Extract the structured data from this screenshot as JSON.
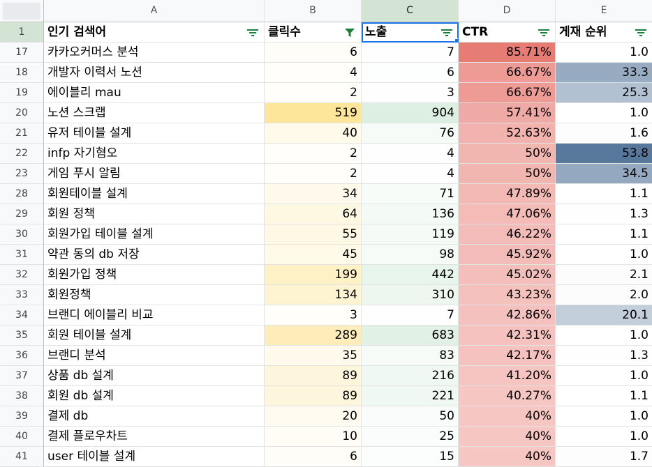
{
  "columns": [
    {
      "letter": "A"
    },
    {
      "letter": "B"
    },
    {
      "letter": "C"
    },
    {
      "letter": "D"
    },
    {
      "letter": "E"
    }
  ],
  "header_row": {
    "index": "1",
    "a": "인기 검색어",
    "b": "클릭수",
    "c": "노출",
    "d": "CTR",
    "e": "게재 순위"
  },
  "rows": [
    {
      "index": "17",
      "term": "카카오커머스 분석",
      "clicks": "6",
      "impressions": "7",
      "ctr": "85.71%",
      "position": "1.0"
    },
    {
      "index": "18",
      "term": "개발자 이력서 노션",
      "clicks": "4",
      "impressions": "6",
      "ctr": "66.67%",
      "position": "33.3"
    },
    {
      "index": "19",
      "term": "에이블리 mau",
      "clicks": "2",
      "impressions": "3",
      "ctr": "66.67%",
      "position": "25.3"
    },
    {
      "index": "20",
      "term": "노션 스크랩",
      "clicks": "519",
      "impressions": "904",
      "ctr": "57.41%",
      "position": "1.0"
    },
    {
      "index": "21",
      "term": "유저 테이블 설계",
      "clicks": "40",
      "impressions": "76",
      "ctr": "52.63%",
      "position": "1.6"
    },
    {
      "index": "22",
      "term": "infp 자기혐오",
      "clicks": "2",
      "impressions": "4",
      "ctr": "50%",
      "position": "53.8"
    },
    {
      "index": "23",
      "term": "게임 푸시 알림",
      "clicks": "2",
      "impressions": "4",
      "ctr": "50%",
      "position": "34.5"
    },
    {
      "index": "28",
      "term": "회원테이블 설계",
      "clicks": "34",
      "impressions": "71",
      "ctr": "47.89%",
      "position": "1.1"
    },
    {
      "index": "29",
      "term": "회원 정책",
      "clicks": "64",
      "impressions": "136",
      "ctr": "47.06%",
      "position": "1.3"
    },
    {
      "index": "30",
      "term": "회원가입 테이블 설계",
      "clicks": "55",
      "impressions": "119",
      "ctr": "46.22%",
      "position": "1.1"
    },
    {
      "index": "31",
      "term": "약관 동의 db 저장",
      "clicks": "45",
      "impressions": "98",
      "ctr": "45.92%",
      "position": "1.0"
    },
    {
      "index": "32",
      "term": "회원가입 정책",
      "clicks": "199",
      "impressions": "442",
      "ctr": "45.02%",
      "position": "2.1"
    },
    {
      "index": "33",
      "term": "회원정책",
      "clicks": "134",
      "impressions": "310",
      "ctr": "43.23%",
      "position": "2.0"
    },
    {
      "index": "34",
      "term": "브랜디 에이블리 비교",
      "clicks": "3",
      "impressions": "7",
      "ctr": "42.86%",
      "position": "20.1"
    },
    {
      "index": "35",
      "term": "회원 테이블 설계",
      "clicks": "289",
      "impressions": "683",
      "ctr": "42.31%",
      "position": "1.0"
    },
    {
      "index": "36",
      "term": "브랜디 분석",
      "clicks": "35",
      "impressions": "83",
      "ctr": "42.17%",
      "position": "1.3"
    },
    {
      "index": "37",
      "term": "상품 db 설계",
      "clicks": "89",
      "impressions": "216",
      "ctr": "41.20%",
      "position": "1.0"
    },
    {
      "index": "38",
      "term": "회원 db 설계",
      "clicks": "89",
      "impressions": "221",
      "ctr": "40.27%",
      "position": "1.1"
    },
    {
      "index": "39",
      "term": "결제 db",
      "clicks": "20",
      "impressions": "50",
      "ctr": "40%",
      "position": "1.0"
    },
    {
      "index": "40",
      "term": "결제 플로우차트",
      "clicks": "10",
      "impressions": "25",
      "ctr": "40%",
      "position": "1.0"
    },
    {
      "index": "41",
      "term": "user 테이블 설계",
      "clicks": "6",
      "impressions": "15",
      "ctr": "40%",
      "position": "1.7"
    }
  ],
  "colors": {
    "filter_icon": "#188038",
    "active_filter_icon": "#188038",
    "selection": "#1a73e8",
    "clicks_scale_max": "#fde69a",
    "impressions_scale_max": "#dcefe2",
    "ctr_scale_max": "#e67c73",
    "ctr_scale_min": "#f6c6c3",
    "position_scale_max": "#57789a"
  },
  "icons": {
    "filter": "filter-lines-icon",
    "active_filter": "funnel-filled-icon"
  }
}
